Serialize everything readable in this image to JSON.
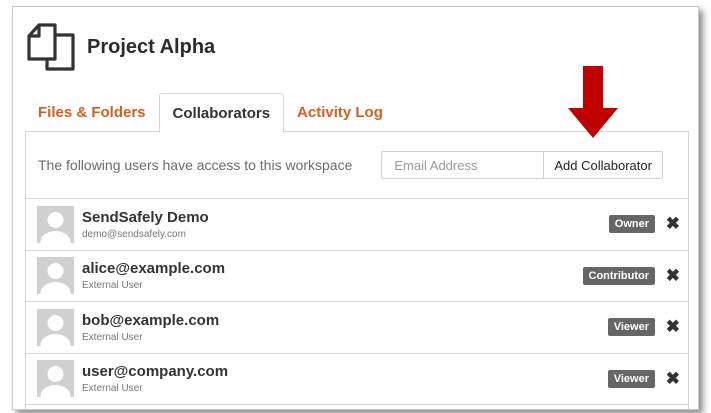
{
  "project": {
    "title": "Project Alpha",
    "icon": "document-copy-icon"
  },
  "tabs": [
    {
      "label": "Files & Folders",
      "active": false
    },
    {
      "label": "Collaborators",
      "active": true
    },
    {
      "label": "Activity Log",
      "active": false
    }
  ],
  "panel": {
    "description": "The following users have access to this workspace",
    "email_placeholder": "Email Address",
    "add_button": "Add Collaborator"
  },
  "users": [
    {
      "name": "SendSafely Demo",
      "subtitle": "demo@sendsafely.com",
      "role": "Owner"
    },
    {
      "name": "alice@example.com",
      "subtitle": "External User",
      "role": "Contributor"
    },
    {
      "name": "bob@example.com",
      "subtitle": "External User",
      "role": "Viewer"
    },
    {
      "name": "user@company.com",
      "subtitle": "External User",
      "role": "Viewer"
    }
  ],
  "colors": {
    "accent": "#d2611f",
    "arrow": "#c00000",
    "badge": "#666666"
  }
}
